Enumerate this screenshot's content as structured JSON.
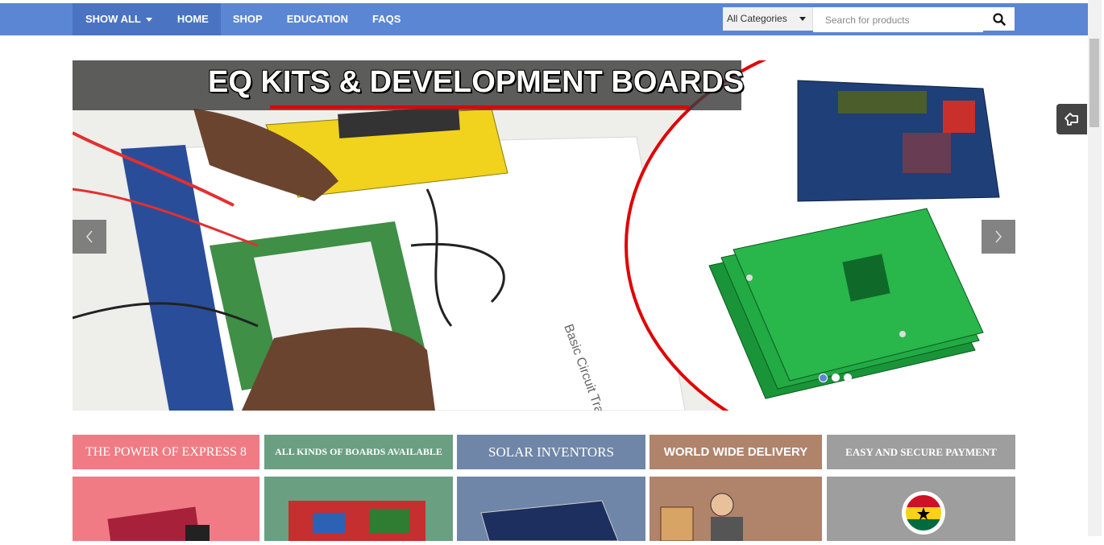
{
  "nav": {
    "show_all_label": "SHOW ALL",
    "items": [
      {
        "label": "HOME"
      },
      {
        "label": "SHOP"
      },
      {
        "label": "EDUCATION"
      },
      {
        "label": "FAQS"
      }
    ]
  },
  "search": {
    "category_selected": "All Categories",
    "placeholder": "Search for products"
  },
  "slider": {
    "title": "EQ KITS & DEVELOPMENT BOARDS",
    "active_slide": 1,
    "slide_count": 3
  },
  "promos": [
    {
      "title": "THE POWER OF EXPRESS 8",
      "color": "#f07b84"
    },
    {
      "title": "ALL KINDS OF BOARDS AVAILABLE",
      "color": "#6a9f81"
    },
    {
      "title": "SOLAR INVENTORS",
      "color": "#6f86a8"
    },
    {
      "title": "WORLD WIDE DELIVERY",
      "color": "#b0836b"
    },
    {
      "title": "EASY AND SECURE PAYMENT",
      "color": "#9e9e9e"
    }
  ],
  "colors": {
    "navbar": "#5b86d3",
    "accent_red": "#e00000"
  },
  "icons": {
    "search": "search-icon",
    "chevron_left": "chevron-left-icon",
    "chevron_right": "chevron-right-icon",
    "tool": "cursor-hand-icon"
  }
}
